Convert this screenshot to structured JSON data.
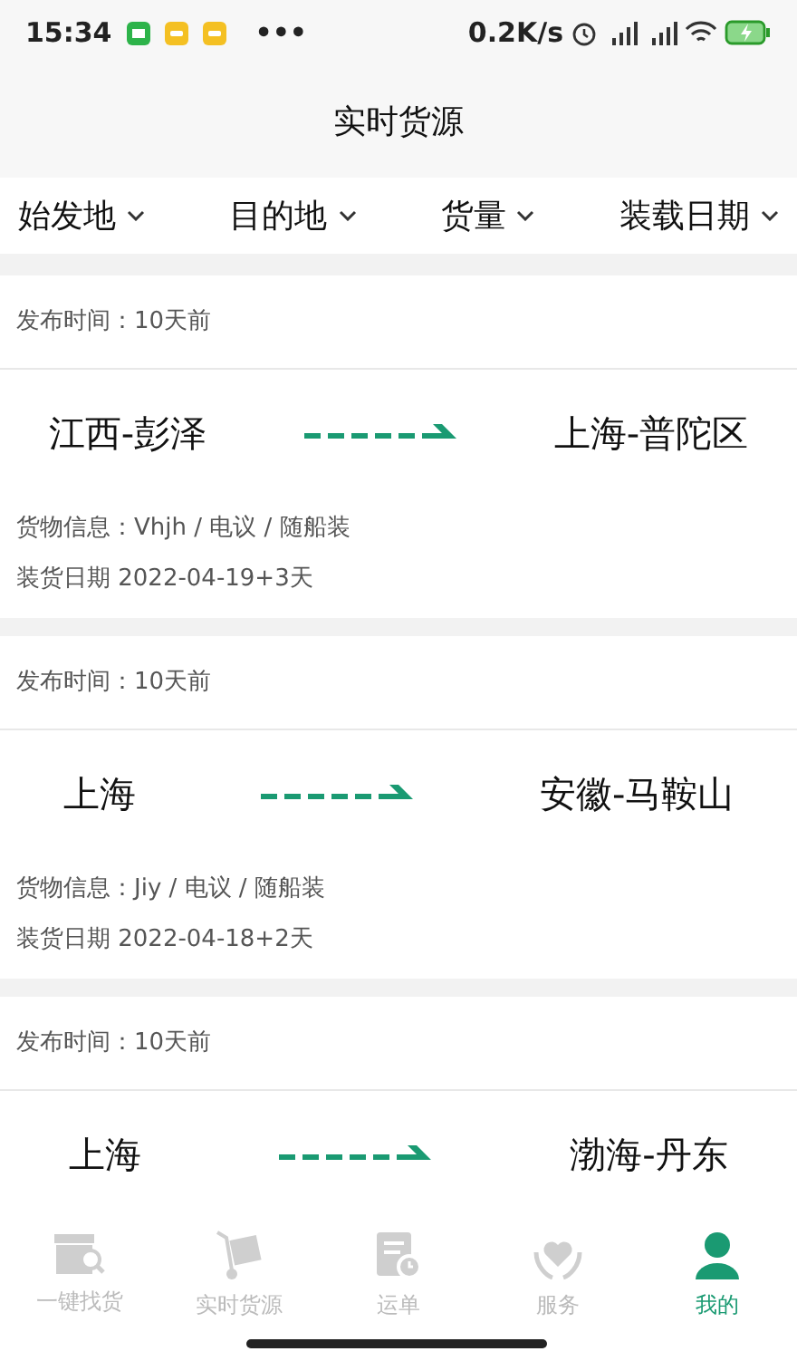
{
  "status_bar": {
    "time": "15:34",
    "more": "•••",
    "speed": "0.2K/s"
  },
  "title": "实时货源",
  "filters": [
    {
      "label": "始发地"
    },
    {
      "label": "目的地"
    },
    {
      "label": "货量"
    },
    {
      "label": "装载日期"
    }
  ],
  "cards": [
    {
      "published": "发布时间：10天前",
      "from": "江西-彭泽",
      "to": "上海-普陀区",
      "goods": "货物信息：Vhjh / 电议 / 随船装",
      "date": "装货日期 2022-04-19+3天"
    },
    {
      "published": "发布时间：10天前",
      "from": "上海",
      "to": "安徽-马鞍山",
      "goods": "货物信息：Jiy / 电议 / 随船装",
      "date": "装货日期 2022-04-18+2天"
    },
    {
      "published": "发布时间：10天前",
      "from": "上海",
      "to": "渤海-丹东"
    }
  ],
  "tab_bar": [
    {
      "label": "一键找货",
      "kind": "search-box",
      "selected": false
    },
    {
      "label": "实时货源",
      "kind": "cart",
      "selected": false
    },
    {
      "label": "运单",
      "kind": "doc",
      "selected": false
    },
    {
      "label": "服务",
      "kind": "heart",
      "selected": false
    },
    {
      "label": "我的",
      "kind": "person",
      "selected": true
    }
  ]
}
